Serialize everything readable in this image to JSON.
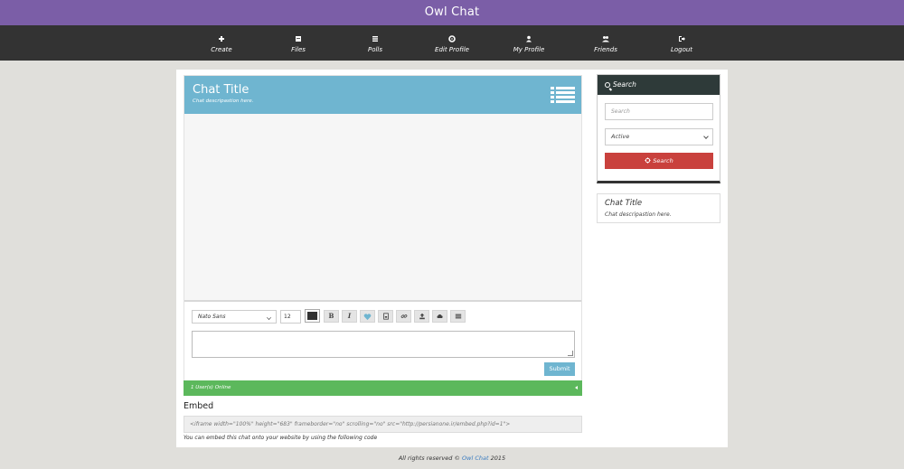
{
  "app": {
    "title": "Owl Chat"
  },
  "nav": {
    "items": [
      {
        "label": "Create",
        "icon": "plus-icon"
      },
      {
        "label": "Files",
        "icon": "file-icon"
      },
      {
        "label": "Polls",
        "icon": "list-icon"
      },
      {
        "label": "Edit Profile",
        "icon": "gear-icon"
      },
      {
        "label": "My Profile",
        "icon": "user-icon"
      },
      {
        "label": "Friends",
        "icon": "users-icon"
      },
      {
        "label": "Logout",
        "icon": "logout-icon"
      }
    ]
  },
  "chat": {
    "title": "Chat Title",
    "description": "Chat descripastion here.",
    "online_text": "1 User(s) Online"
  },
  "editor": {
    "font_family": "Nato Sans",
    "font_size": "12",
    "text_color": "#333333",
    "submit_label": "Submit",
    "message_value": "",
    "toolbar": [
      {
        "label": "B",
        "icon": "bold-icon"
      },
      {
        "label": "I",
        "icon": "italic-icon"
      },
      {
        "label": "",
        "icon": "heart-icon"
      },
      {
        "label": "",
        "icon": "image-file-icon"
      },
      {
        "label": "",
        "icon": "link-icon"
      },
      {
        "label": "",
        "icon": "upload-icon"
      },
      {
        "label": "",
        "icon": "cloud-icon"
      },
      {
        "label": "",
        "icon": "menu-icon"
      }
    ]
  },
  "embed": {
    "heading": "Embed",
    "code": "<iframe width=\"100%\" height=\"683\" frameborder=\"no\" scrolling=\"no\" src=\"http://persianone.ir/embed.php?id=1\">",
    "note": "You can embed this chat onto your website by using the following code"
  },
  "search": {
    "heading": "Search",
    "placeholder": "Search",
    "status_value": "Active",
    "button_label": "Search"
  },
  "info": {
    "title": "Chat Title",
    "description": "Chat descripastion here."
  },
  "footer": {
    "prefix": "All rights reserved © ",
    "link": "Owl Chat",
    "year": " 2015"
  },
  "colors": {
    "brand": "#7b5ea7",
    "navbar": "#333333",
    "chat_header": "#6fb5d0",
    "online_bar": "#5cb85c",
    "search_button": "#c9413d",
    "search_header": "#2e3a39"
  }
}
